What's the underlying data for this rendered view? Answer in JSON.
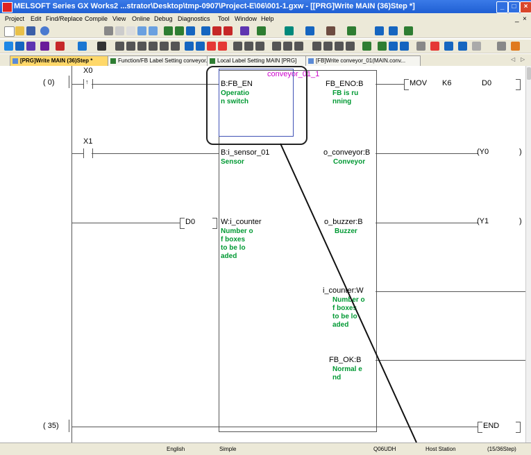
{
  "window": {
    "title": "MELSOFT Series GX Works2 ...strator\\Desktop\\tmp-0907\\Project-E\\06\\001-1.gxw - [[PRG]Write MAIN (36)Step *]"
  },
  "menu": [
    "Project",
    "Edit",
    "Find/Replace",
    "Compile",
    "View",
    "Online",
    "Debug",
    "Diagnostics",
    "Tool",
    "Window",
    "Help"
  ],
  "tabs": [
    {
      "label": "[PRG]Write MAIN (36)Step *"
    },
    {
      "label": "Function/FB Label Setting conveyor..."
    },
    {
      "label": "Local Label Setting MAIN [PRG]"
    },
    {
      "label": "[FB]Write conveyor_01(MAIN.conv..."
    }
  ],
  "ladder": {
    "rung1_step": "(    0)",
    "rung2_step": "(   35)",
    "contact1": "X0",
    "contact2": "X1",
    "d0_input": "D0",
    "fb_instance": "conveyor_01_1",
    "in1_label": "B:FB_EN",
    "in1_comment": [
      "Operatio",
      "n switch"
    ],
    "in2_label": "B:i_sensor_01",
    "in2_comment": [
      "Sensor"
    ],
    "in3_label": "W:i_counter",
    "in3_comment": [
      "Number o",
      "f boxes",
      "to be lo",
      "aded"
    ],
    "out1_label": "FB_ENO:B",
    "out1_comment": [
      "FB is ru",
      "nning"
    ],
    "out2_label": "o_conveyor:B",
    "out2_comment": [
      "Conveyor"
    ],
    "out3_label": "o_buzzer:B",
    "out3_comment": [
      "Buzzer"
    ],
    "out4_label": "i_counter:W",
    "out4_comment": [
      "Number o",
      "f boxes",
      "to be lo",
      "aded"
    ],
    "out5_label": "FB_OK:B",
    "out5_comment": [
      "Normal e",
      "nd"
    ],
    "mov_instr": "MOV",
    "mov_src": "K6",
    "mov_dst": "D0",
    "coil1": "Y0",
    "coil2": "Y1",
    "end_instr": "END"
  },
  "statusbar": {
    "language": "English",
    "mode": "Simple",
    "cpu": "Q06UDH",
    "station": "Host Station",
    "steps": "(15/36Step)"
  }
}
